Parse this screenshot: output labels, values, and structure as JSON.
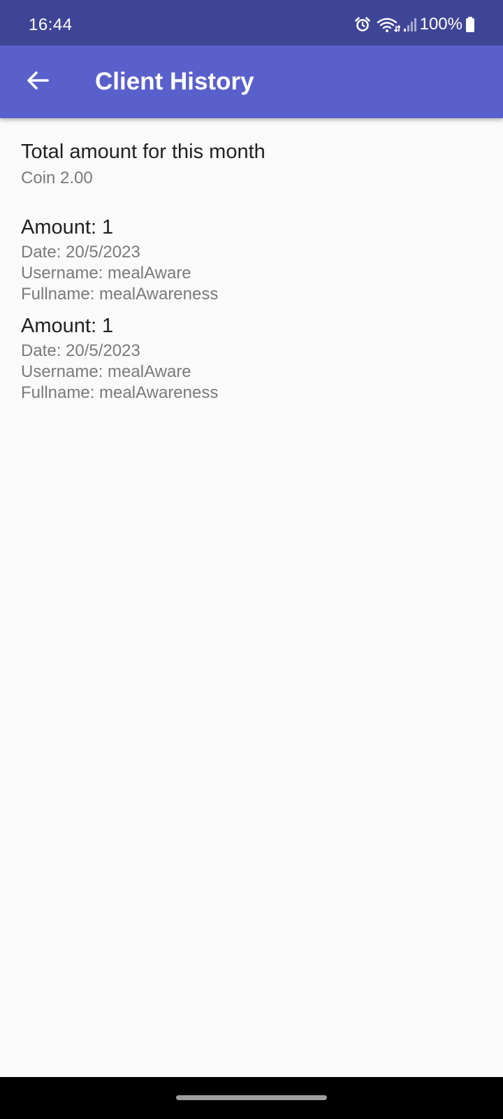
{
  "status_bar": {
    "time": "16:44",
    "battery_percent": "100%",
    "icons": [
      "alarm-icon",
      "wifi-icon",
      "signal-icon",
      "battery-icon"
    ]
  },
  "app_bar": {
    "title": "Client History",
    "back_icon": "arrow-left-icon",
    "background_color": "#5960cc"
  },
  "summary": {
    "title": "Total amount for this month",
    "value": "Coin 2.00"
  },
  "transactions": [
    {
      "amount": "Amount: 1",
      "date": "Date: 20/5/2023",
      "username": "Username: mealAware",
      "fullname": "Fullname: mealAwareness"
    },
    {
      "amount": "Amount: 1",
      "date": "Date: 20/5/2023",
      "username": "Username: mealAware",
      "fullname": "Fullname: mealAwareness"
    }
  ],
  "colors": {
    "status_bar": "#3f4596",
    "app_bar": "#5960cc",
    "background": "#fafafa",
    "primary_text": "#212121",
    "secondary_text": "#7a7a7a"
  }
}
